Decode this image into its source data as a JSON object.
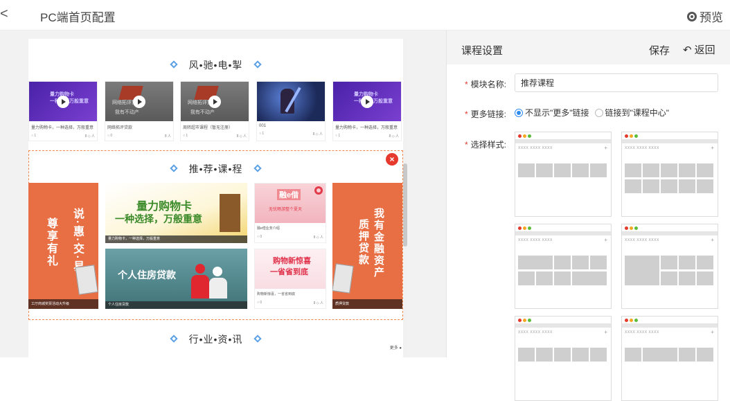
{
  "header": {
    "back_icon": "chevron-left-icon",
    "back_glyph": "<",
    "title": "PC端首页配置",
    "preview_label": "预览"
  },
  "canvas": {
    "section1": {
      "title": "风•驰•电•掣",
      "cards": [
        {
          "name": "量力购物卡，一种选择，万般重意",
          "lock": "○ 1",
          "stat": "8 ◇ 人",
          "banner": "量力购物卡\n一种选择万般重意"
        },
        {
          "name": "网络拓评贷款",
          "lock": "○ 0",
          "stat": "8 人",
          "banner": "网络拓评贷款\n我有不动产"
        },
        {
          "name": "周转超市课程（暂无注册）",
          "lock": "○ 1",
          "stat": "8 ◇ 人",
          "banner": "网络拓评贷款\n我有不动产"
        },
        {
          "name": "001",
          "lock": "○ 1",
          "stat": "8 ◇ 人",
          "banner": ""
        },
        {
          "name": "量力购物卡，一种选择，万般重意",
          "lock": "○ 1",
          "stat": "8 ◇ 人",
          "banner": "量力购物卡\n一种选择万般重意"
        }
      ]
    },
    "section2": {
      "title": "推•荐•课•程",
      "close_glyph": "×",
      "left_banner": {
        "line1": "尊享有礼",
        "line2": "说·惠·交·易",
        "caption": "工厅商城奖票活动大升级"
      },
      "mid_top": {
        "line1": "量力购物卡",
        "line2": "一种选择，万般重意",
        "caption": "量力购物卡，一种选择，万般重意"
      },
      "mid_bottom": {
        "line1": "个人住房贷款",
        "caption": "个人住房贷款"
      },
      "small_top": {
        "logo": "融e借",
        "tag": "无忧畅游整个夏天",
        "name": "融e借业务介绍",
        "lock": "○ 0",
        "stat": "8 ◇ 人"
      },
      "small_bottom": {
        "line1": "购物新惊喜",
        "line2": "一省省到底",
        "name": "购物新惊喜，一省省到底",
        "lock": "○ 0",
        "stat": "8 ◇ 人"
      },
      "right_banner": {
        "line1": "我有金融资产",
        "line2": "质押贷款",
        "caption": "质押贷款"
      }
    },
    "section3": {
      "title": "行•业•资•讯",
      "more": "更多 ●"
    }
  },
  "panel": {
    "title": "课程设置",
    "save_label": "保存",
    "return_label": "返回",
    "return_icon": "undo-icon",
    "return_glyph": "↶",
    "module_name_label": "模块名称:",
    "module_name_value": "推荐课程",
    "more_link_label": "更多链接:",
    "more_options": [
      "不显示\"更多\"链接",
      "链接到\"课程中心\""
    ],
    "more_selected": 0,
    "style_label": "选择样式:",
    "style_header_text": "XXXX  XXXX  XXXX",
    "plus": "+",
    "required_mark": "*",
    "dot_colors": [
      "#e5392c",
      "#f5a623",
      "#5bbd3a"
    ]
  }
}
